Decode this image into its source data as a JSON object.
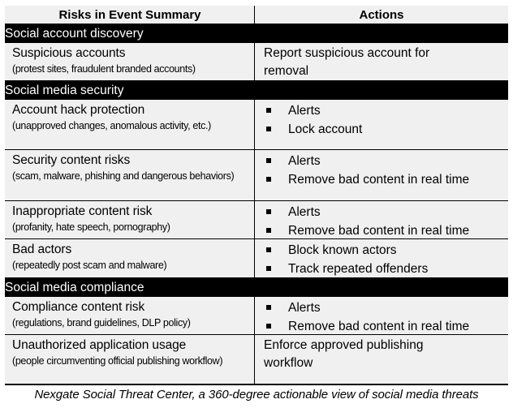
{
  "header": {
    "risks": "Risks in Event Summary",
    "actions": "Actions"
  },
  "sections": [
    {
      "title": "Social account discovery",
      "rows": [
        {
          "risk": "Suspicious accounts",
          "detail": "(protest sites, fraudulent branded accounts)",
          "action_text": "Report suspicious account for removal"
        }
      ]
    },
    {
      "title": "Social media security",
      "rows": [
        {
          "risk": "Account hack protection",
          "detail": "(unapproved changes, anomalous activity, etc.)",
          "actions": [
            "Alerts",
            "Lock account"
          ]
        },
        {
          "risk": "Security content risks",
          "detail": "(scam, malware, phishing and dangerous behaviors)",
          "actions": [
            "Alerts",
            "Remove bad content in real time"
          ]
        },
        {
          "risk": "Inappropriate content risk",
          "detail": "(profanity, hate speech, pornography)",
          "actions": [
            "Alerts",
            "Remove bad content in real time"
          ]
        },
        {
          "risk": "Bad actors",
          "detail": "(repeatedly post scam and malware)",
          "actions": [
            "Block known actors",
            "Track repeated offenders"
          ]
        }
      ]
    },
    {
      "title": "Social media compliance",
      "rows": [
        {
          "risk": "Compliance content risk",
          "detail": "(regulations, brand guidelines, DLP policy)",
          "actions": [
            "Alerts",
            "Remove bad content in real time"
          ]
        },
        {
          "risk": "Unauthorized application usage",
          "detail": "(people circumventing official publishing workflow)",
          "action_text": "Enforce approved publishing workflow"
        }
      ]
    }
  ],
  "caption": "Nexgate Social Threat Center, a 360-degree actionable view of social media threats"
}
